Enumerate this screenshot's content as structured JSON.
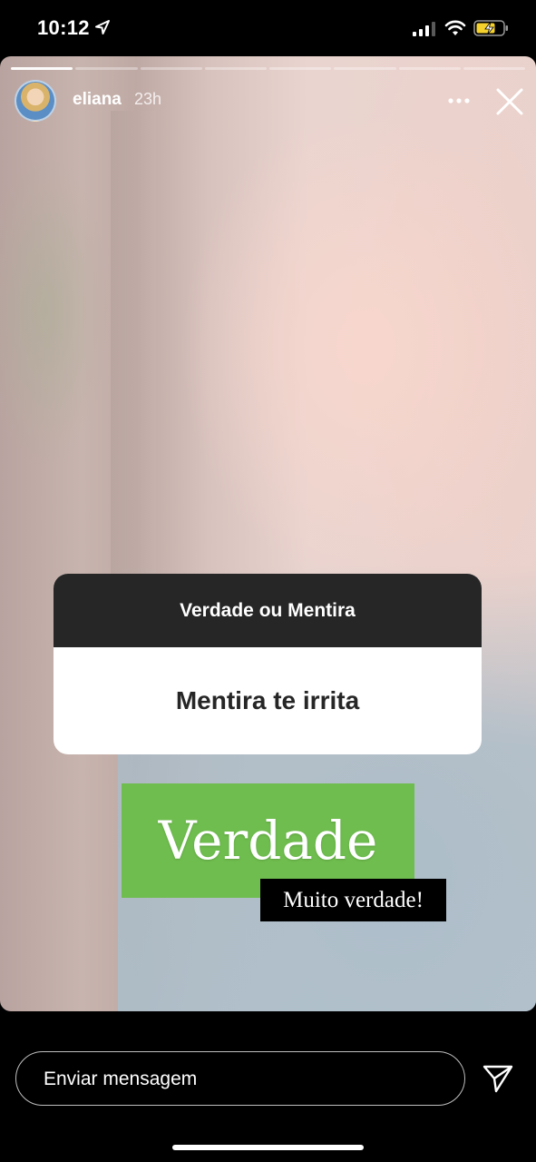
{
  "status_bar": {
    "time": "10:12"
  },
  "story": {
    "progress": {
      "segments": 8,
      "active_index": 0
    },
    "user": {
      "name": "eliana",
      "age": "23h"
    },
    "question_sticker": {
      "title": "Verdade ou Mentira",
      "question": "Mentira te irrita"
    },
    "answer_label": "Verdade",
    "answer_caption": "Muito verdade!",
    "colors": {
      "answer_bg": "#6fbd4e",
      "sticker_header": "#262626"
    }
  },
  "reply": {
    "placeholder": "Enviar mensagem"
  },
  "icons": [
    "location-arrow-icon",
    "signal-icon",
    "wifi-icon",
    "battery-charging-icon",
    "more-icon",
    "close-icon",
    "send-icon"
  ]
}
